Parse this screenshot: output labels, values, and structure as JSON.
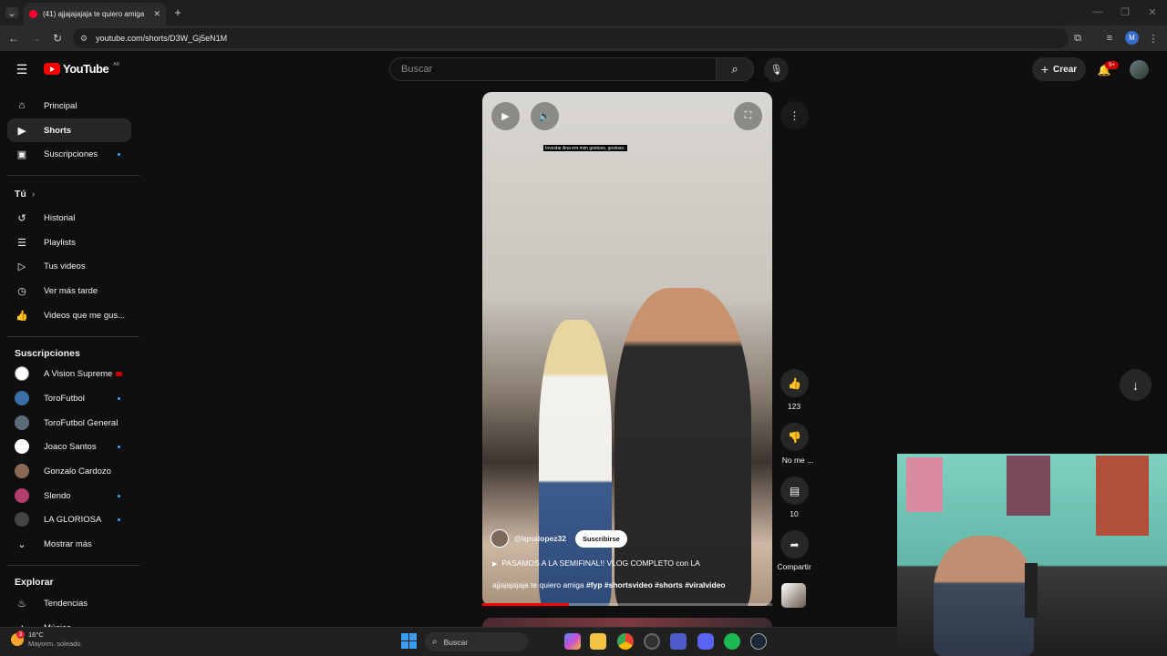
{
  "browser": {
    "tab_title": "(41) ajjajajajaja te quiero amiga",
    "url": "youtube.com/shorts/D3W_Gj5eN1M",
    "profile_initial": "M"
  },
  "header": {
    "logo_text": "YouTube",
    "country": "AR",
    "search_placeholder": "Buscar",
    "create_label": "Crear",
    "notifications_badge": "9+"
  },
  "sidebar": {
    "main": [
      {
        "label": "Principal",
        "icon": "home-icon"
      },
      {
        "label": "Shorts",
        "icon": "shorts-icon",
        "active": true
      },
      {
        "label": "Suscripciones",
        "icon": "subscriptions-icon"
      }
    ],
    "you_heading": "Tú",
    "you": [
      {
        "label": "Historial",
        "icon": "history-icon"
      },
      {
        "label": "Playlists",
        "icon": "playlists-icon"
      },
      {
        "label": "Tus videos",
        "icon": "your-videos-icon"
      },
      {
        "label": "Ver más tarde",
        "icon": "watch-later-icon"
      },
      {
        "label": "Videos que me gus...",
        "icon": "liked-icon"
      }
    ],
    "subs_heading": "Suscripciones",
    "subs": [
      {
        "label": "A Vision Supreme",
        "color": "#ffffff",
        "live": true
      },
      {
        "label": "ToroFutbol",
        "color": "#3a6ea8"
      },
      {
        "label": "ToroFutbol General",
        "color": "#5a6b7c"
      },
      {
        "label": "Joaco Santos",
        "color": "#ffffff"
      },
      {
        "label": "Gonzalo Cardozo",
        "color": "#8a6a55"
      },
      {
        "label": "Slendo",
        "color": "#b0406a"
      },
      {
        "label": "LA GLORIOSA",
        "color": "#444444"
      }
    ],
    "show_more": "Mostrar más",
    "explore_heading": "Explorar",
    "explore": [
      {
        "label": "Tendencias",
        "icon": "trending-icon"
      },
      {
        "label": "Música",
        "icon": "music-icon"
      }
    ]
  },
  "short": {
    "caption_overlay": "Investar Ana em mim gostoso, gostoso.",
    "channel": "@ignalopez32",
    "subscribe_label": "Suscribirse",
    "title": "PASAMOS A LA SEMIFINAL!! VLOG COMPLETO con LA",
    "description": "ajjajajajaja te quiero amiga",
    "hashtags": "#fyp #shortsvideo #shorts #viralvideo",
    "progress": 0.3
  },
  "actions": {
    "likes": "123",
    "dislike_label": "No me ...",
    "comments": "10",
    "share_label": "Compartir"
  },
  "taskbar": {
    "weather_temp": "16°C",
    "weather_desc": "Mayorm. soleado",
    "search_label": "Buscar",
    "weather_badge": "3"
  },
  "colors": {
    "brand_red": "#ff0000",
    "accent_blue": "#3ea6ff",
    "background": "#0f0f0f"
  }
}
